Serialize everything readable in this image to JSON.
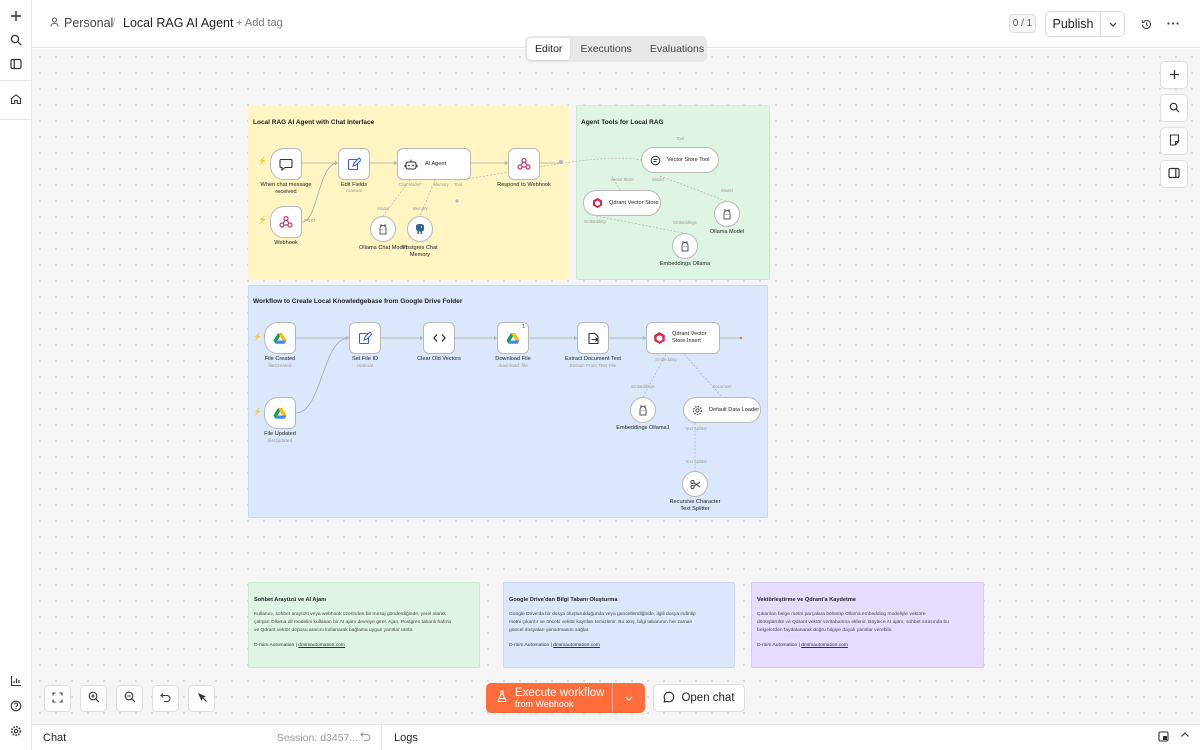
{
  "header": {
    "breadcrumb_personal": "Personal",
    "breadcrumb_sep": "/",
    "workflow_title": "Local RAG AI Agent",
    "add_tag": "+ Add tag",
    "version_badge": "0 / 1",
    "publish_label": "Publish"
  },
  "tabs": [
    "Editor",
    "Executions",
    "Evaluations"
  ],
  "notes": {
    "chat_group_title": "Local RAG AI Agent with Chat Interface",
    "tools_group_title": "Agent Tools for Local RAG",
    "kb_group_title": "Workflow to Create Local Knowledgebase from Google Drive Folder"
  },
  "nodes": {
    "chat_trigger": "When chat message received",
    "webhook": "Webhook",
    "edit_fields": "Edit Fields",
    "edit_fields_sub": "manual",
    "ai_agent": "AI Agent",
    "respond_webhook": "Respond to Webhook",
    "ollama_chat_model": "Ollama Chat Model",
    "postgres_memory": "Postgres Chat Memory",
    "vector_store_tool": "Vector Store Tool",
    "qdrant_vector_store": "Qdrant Vector Store",
    "ollama_model": "Ollama Model",
    "embeddings_ollama": "Embeddings Ollama",
    "file_created": "File Created",
    "file_created_sub": "fileCreated",
    "file_updated": "File Updated",
    "file_updated_sub": "fileUpdated",
    "set_file_id": "Set File ID",
    "set_file_id_sub": "manual",
    "clear_old_vectors": "Clear Old Vectors",
    "download_file": "Download File",
    "download_file_sub": "download: file",
    "download_badge": "1",
    "extract_text": "Extract Document Text",
    "extract_text_sub": "Extract From Text File",
    "qdrant_insert": "Qdrant Vector Store Insert",
    "embeddings_ollama1": "Embeddings Ollama1",
    "default_data_loader": "Default Data Loader",
    "text_splitter": "Recursive Character Text Splitter"
  },
  "ports": {
    "chat_model": "Chat Model*",
    "memory": "Memory",
    "tool": "Tool",
    "model": "Model",
    "vector_store": "Vector Store",
    "embedding": "Embedding",
    "embeddings": "Embeddings",
    "document": "Document",
    "text_splitter": "Text Splitter",
    "webhook_out": "POST"
  },
  "descriptions": [
    {
      "title": "Sohbet Arayüzü ve AI Ajanı",
      "lines": [
        "Kullanıcı, sohbet arayüzü veya webhook üzerinden bir mesaj gönderdiğinde, yerel olarak",
        "çalışan Ollama dil modelini kullanan bir AI ajanı devreye girer. Ajan, Postgres tabanlı hafıza",
        "ve Qdrant vektör deposu aracını kullanarak bağlama uygun yanıtlar üretir."
      ],
      "credit": "D-mim Automation | ",
      "link": "dmimautomation.com"
    },
    {
      "title": "Google Drive'dan Bilgi Tabanı Oluşturma",
      "lines": [
        "Google Drive'da bir dosya oluşturulduğunda veya güncellendiğinde, ilgili dosya indirilip",
        "metni çıkarılır ve önceki vektör kayıtları temizlenir. Bu akış, bilgi tabanının her zaman",
        "güncel dosyaları yansıtmasını sağlar."
      ],
      "credit": "D-mim Automation | ",
      "link": "dmimautomation.com"
    },
    {
      "title": "Vektörleştirme ve Qdrant'a Kaydetme",
      "lines": [
        "Çıkarılan belge metni parçalara bölünüp Ollama embedding modeliyle vektöre",
        "dönüştürülür ve Qdrant vektör veritabanına eklenir. Böylece AI ajanı, sohbet sırasında bu",
        "belgelerden faydalanarak doğru bilgiye dayalı yanıtlar verebilir."
      ],
      "credit": "D-mim Automation | ",
      "link": "dmimautomation.com"
    }
  ],
  "actions": {
    "execute_line1": "Execute workflow",
    "execute_line2": "from Webhook",
    "open_chat": "Open chat"
  },
  "bottombar": {
    "chat": "Chat",
    "session": "Session: d3457...",
    "logs": "Logs"
  },
  "colors": {
    "accent": "#ff6d3c",
    "note_yellow": "#fff5c2",
    "note_green": "#dff5e4",
    "note_blue": "#dbe8fb",
    "note_purple": "#e6dcff"
  }
}
